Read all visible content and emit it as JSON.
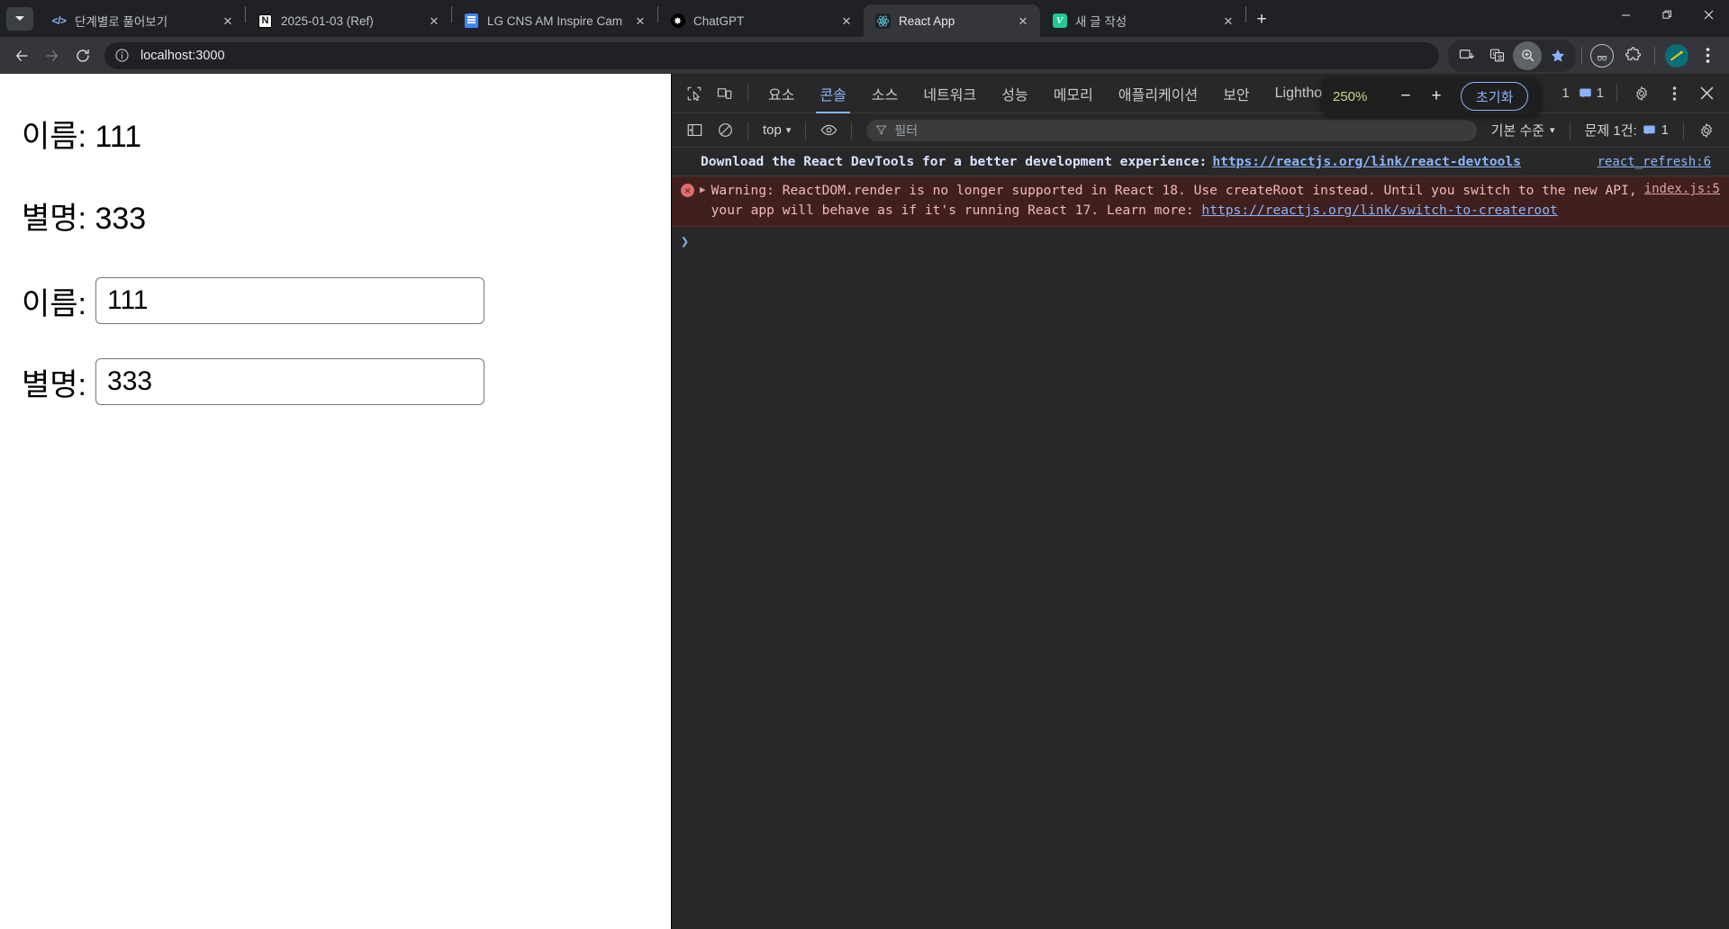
{
  "browser": {
    "tab_list_icon": "chevron-down-icon",
    "tabs": [
      {
        "title": "단계별로 풀어보기",
        "favicon": "code-icon",
        "active": false
      },
      {
        "title": "2025-01-03 (Ref)",
        "favicon": "notion-icon",
        "active": false
      },
      {
        "title": "LG CNS AM Inspire Camp - Go",
        "favicon": "google-docs-icon",
        "active": false
      },
      {
        "title": "ChatGPT",
        "favicon": "chatgpt-icon",
        "active": false
      },
      {
        "title": "React App",
        "favicon": "react-icon",
        "active": true
      },
      {
        "title": "새 글 작성",
        "favicon": "velog-icon",
        "active": false
      }
    ],
    "new_tab_label": "+",
    "window_controls": {
      "minimize": "—",
      "maximize": "❐",
      "close": "✕"
    },
    "toolbar": {
      "back": "←",
      "forward": "→",
      "reload": "⟳",
      "site_info_icon": "info-circle-icon",
      "url": "localhost:3000",
      "install_icon": "install-app-icon",
      "translate_icon": "translate-icon",
      "zoom_icon": "zoom-magnifier-icon",
      "bookmark_icon": "star-icon",
      "incognito_icon": "profile-icon",
      "extensions_icon": "puzzle-icon",
      "profile_icon": "avatar-icon",
      "menu_icon": "three-dot-menu-icon"
    }
  },
  "page": {
    "name_paragraph": "이름: 111",
    "nickname_paragraph": "별명: 333",
    "name_label": "이름:",
    "name_value": "111",
    "nickname_label": "별명:",
    "nickname_value": "333"
  },
  "devtools": {
    "inspect_icon": "inspect-element-icon",
    "device_icon": "device-toolbar-icon",
    "tabs": [
      {
        "label": "요소",
        "selected": false
      },
      {
        "label": "콘솔",
        "selected": true
      },
      {
        "label": "소스",
        "selected": false
      },
      {
        "label": "네트워크",
        "selected": false
      },
      {
        "label": "성능",
        "selected": false
      },
      {
        "label": "메모리",
        "selected": false
      },
      {
        "label": "애플리케이션",
        "selected": false
      },
      {
        "label": "보안",
        "selected": false
      },
      {
        "label": "Lighthouse",
        "selected": false
      }
    ],
    "warning_count": "1",
    "message_count": "1",
    "settings_icon": "gear-icon",
    "more_icon": "three-dot-menu-icon",
    "close_icon": "close-icon",
    "zoom_popup": {
      "value": "250%",
      "minus": "−",
      "plus": "+",
      "reset_label": "초기화"
    },
    "console_toolbar": {
      "sidebar_icon": "console-sidebar-icon",
      "clear_icon": "clear-console-icon",
      "context": "top",
      "context_caret": "▾",
      "eye_icon": "live-expression-icon",
      "filter_icon": "filter-icon",
      "filter_placeholder": "필터",
      "level_label": "기본 수준",
      "level_caret": "▾",
      "issues_label": "문제 1건:",
      "issues_icon": "issues-message-icon",
      "issues_count": "1",
      "settings_icon": "gear-icon"
    },
    "console_messages": [
      {
        "type": "info",
        "text": "Download the React DevTools for a better development experience:",
        "link": "https://reactjs.org/link/react-devtools",
        "source": "react_refresh:6"
      },
      {
        "type": "error",
        "expander": "▶",
        "text_part1": "Warning: ReactDOM.render is no longer supported in React 18. Use createRoot instead. Until you switch to the new API, your",
        "text_part2": "app will behave as if it's running React 17. Learn more:",
        "link": "https://reactjs.org/link/switch-to-createroot",
        "source": "index.js:5"
      }
    ],
    "prompt_chevron": "❯"
  }
}
